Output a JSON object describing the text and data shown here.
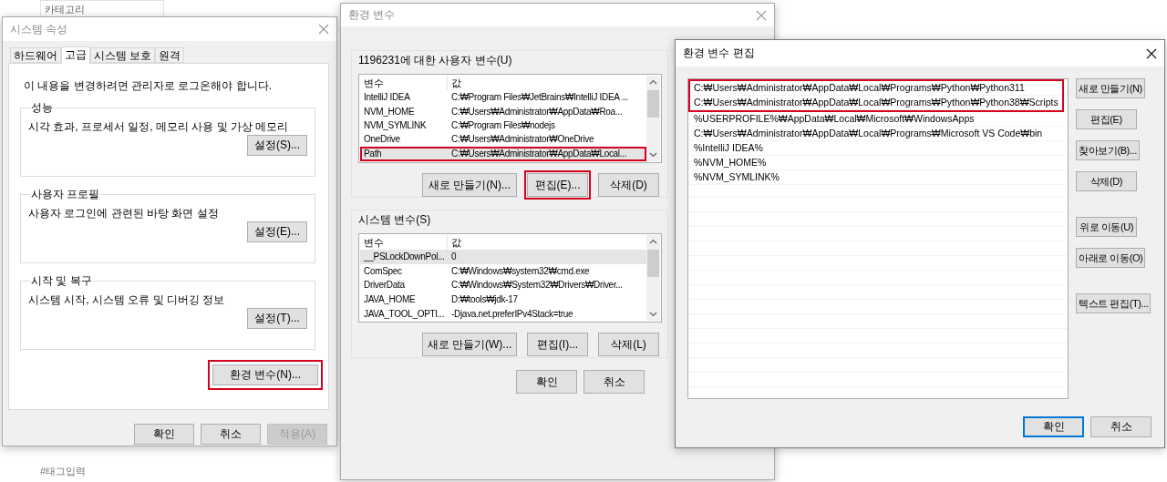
{
  "page": {
    "category_select": "카테고리",
    "tag_input": "#태그입력"
  },
  "system_properties": {
    "title": "시스템 속성",
    "active": false,
    "tabs": [
      {
        "label": "하드웨어",
        "selected": false
      },
      {
        "label": "고급",
        "selected": true
      },
      {
        "label": "시스템 보호",
        "selected": false
      },
      {
        "label": "원격",
        "selected": false
      }
    ],
    "notice": "이 내용을 변경하려면 관리자로 로그온해야 합니다.",
    "groups": [
      {
        "title": "성능",
        "description": "시각 효과, 프로세서 일정, 메모리 사용 및 가상 메모리",
        "button": "설정(S)..."
      },
      {
        "title": "사용자 프로필",
        "description": "사용자 로그인에 관련된 바탕 화면 설정",
        "button": "설정(E)..."
      },
      {
        "title": "시작 및 복구",
        "description": "시스템 시작, 시스템 오류 및 디버깅 정보",
        "button": "설정(T)..."
      }
    ],
    "env_button": {
      "label": "환경 변수(N)...",
      "highlighted": true
    },
    "footer": [
      {
        "label": "확인",
        "disabled": false
      },
      {
        "label": "취소",
        "disabled": false
      },
      {
        "label": "적용(A)",
        "disabled": true
      }
    ]
  },
  "environment_variables": {
    "title": "환경 변수",
    "active": false,
    "sections": [
      {
        "title": "1196231에 대한 사용자 변수(U)",
        "columns": [
          "변수",
          "값"
        ],
        "rows": [
          {
            "name": "IntelliJ IDEA",
            "value": "C:₩Program Files₩JetBrains₩IntelliJ IDEA ...",
            "selected": false,
            "highlighted": false
          },
          {
            "name": "NVM_HOME",
            "value": "C:₩Users₩Administrator₩AppData₩Roa...",
            "selected": false,
            "highlighted": false
          },
          {
            "name": "NVM_SYMLINK",
            "value": "C:₩Program Files₩nodejs",
            "selected": false,
            "highlighted": false
          },
          {
            "name": "OneDrive",
            "value": "C:₩Users₩Administrator₩OneDrive",
            "selected": false,
            "highlighted": false
          },
          {
            "name": "Path",
            "value": "C:₩Users₩Administrator₩AppData₩Local...",
            "selected": true,
            "highlighted": true
          }
        ],
        "buttons": [
          {
            "label": "새로 만들기(N)...",
            "highlighted": false
          },
          {
            "label": "편집(E)...",
            "highlighted": true
          },
          {
            "label": "삭제(D)",
            "highlighted": false
          }
        ]
      },
      {
        "title": "시스템 변수(S)",
        "columns": [
          "변수",
          "값"
        ],
        "rows": [
          {
            "name": "__PSLockDownPol...",
            "value": "0",
            "selected": true,
            "highlighted": false
          },
          {
            "name": "ComSpec",
            "value": "C:₩Windows₩system32₩cmd.exe",
            "selected": false,
            "highlighted": false
          },
          {
            "name": "DriverData",
            "value": "C:₩Windows₩System32₩Drivers₩Driver...",
            "selected": false,
            "highlighted": false
          },
          {
            "name": "JAVA_HOME",
            "value": "D:₩tools₩jdk-17",
            "selected": false,
            "highlighted": false
          },
          {
            "name": "JAVA_TOOL_OPTI...",
            "value": "-Djava.net.preferIPv4Stack=true",
            "selected": false,
            "highlighted": false
          }
        ],
        "buttons": [
          {
            "label": "새로 만들기(W)...",
            "highlighted": false
          },
          {
            "label": "편집(I)...",
            "highlighted": false
          },
          {
            "label": "삭제(L)",
            "highlighted": false
          }
        ]
      }
    ],
    "footer": [
      "확인",
      "취소"
    ]
  },
  "edit_environment_variable": {
    "title": "환경 변수 편집",
    "active": true,
    "entries": [
      {
        "text": "C:₩Users₩Administrator₩AppData₩Local₩Programs₩Python₩Python311",
        "highlighted": true
      },
      {
        "text": "C:₩Users₩Administrator₩AppData₩Local₩Programs₩Python₩Python38₩Scripts",
        "highlighted": true
      },
      {
        "text": "%USERPROFILE%₩AppData₩Local₩Microsoft₩WindowsApps",
        "highlighted": false
      },
      {
        "text": "C:₩Users₩Administrator₩AppData₩Local₩Programs₩Microsoft VS Code₩bin",
        "highlighted": false
      },
      {
        "text": "%IntelliJ IDEA%",
        "highlighted": false
      },
      {
        "text": "%NVM_HOME%",
        "highlighted": false
      },
      {
        "text": "%NVM_SYMLINK%",
        "highlighted": false
      }
    ],
    "button_groups": [
      [
        "새로 만들기(N)",
        "편집(E)",
        "찾아보기(B)...",
        "삭제(D)"
      ],
      [
        "위로 이동(U)",
        "아래로 이동(O)"
      ],
      [
        "텍스트 편집(T)..."
      ]
    ],
    "footer": [
      {
        "label": "확인",
        "default": true
      },
      {
        "label": "취소",
        "default": false
      }
    ]
  }
}
